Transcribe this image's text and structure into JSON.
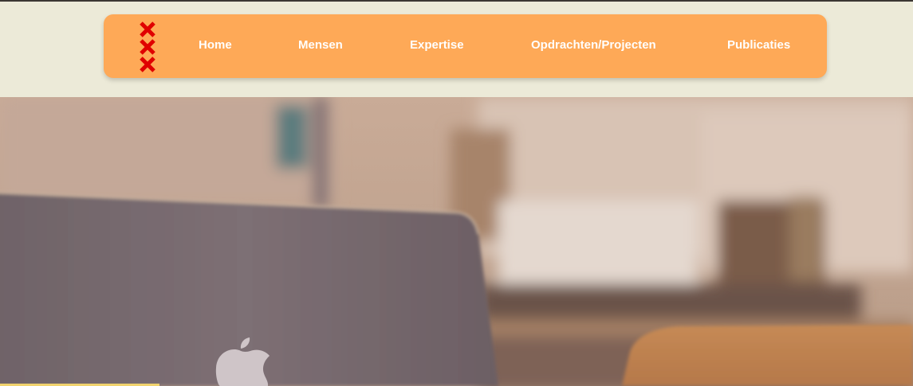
{
  "nav": {
    "logo_icon": "amsterdam-xxx-icon",
    "items": [
      {
        "label": "Home"
      },
      {
        "label": "Mensen"
      },
      {
        "label": "Expertise"
      },
      {
        "label": "Opdrachten/Projecten"
      },
      {
        "label": "Publicaties"
      }
    ]
  },
  "hero": {
    "image_icon": "laptop-photo",
    "brand_icon": "apple-logo-icon"
  },
  "colors": {
    "page_background": "#ecead8",
    "nav_background": "#fea957",
    "nav_text": "#ffffff",
    "logo_red": "#e00000"
  }
}
